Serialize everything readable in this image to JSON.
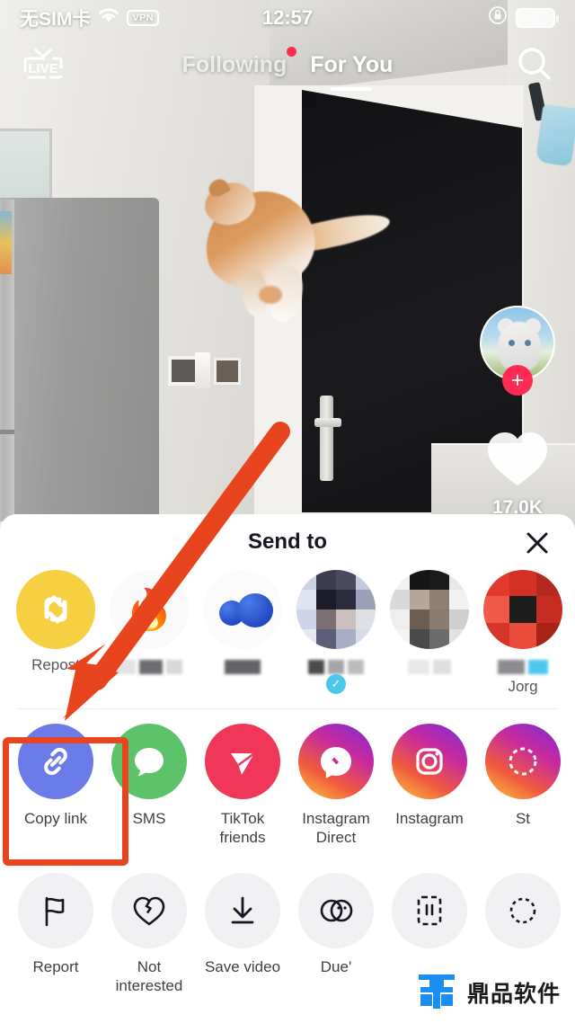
{
  "statusbar": {
    "carrier": "无SIM卡",
    "wifi_icon": "wifi-icon",
    "vpn_label": "VPN",
    "time": "12:57",
    "rotation_lock_icon": "rotation-lock-icon",
    "battery_icon": "battery-icon"
  },
  "topnav": {
    "live_label": "LIVE",
    "tabs": [
      {
        "label": "Following",
        "active": false,
        "has_dot": true
      },
      {
        "label": "For You",
        "active": true,
        "has_dot": false
      }
    ],
    "search_icon": "search-icon"
  },
  "video": {
    "author_avatar_icon": "author-avatar",
    "follow_button_label": "+",
    "like_icon": "heart-icon",
    "like_count": "17.0K"
  },
  "share_sheet": {
    "title": "Send to",
    "close_icon": "close-icon",
    "contacts": [
      {
        "label": "Repost",
        "icon": "repost-icon",
        "name_blurred": false,
        "verified": false
      },
      {
        "label": "",
        "icon": "fire-emoji-avatar",
        "name_blurred": true,
        "verified": false
      },
      {
        "label": "",
        "icon": "blue-faces-avatar",
        "name_blurred": true,
        "verified": false
      },
      {
        "label": "",
        "icon": "pixelated-avatar-1",
        "name_blurred": true,
        "verified": true
      },
      {
        "label": "",
        "icon": "pixelated-avatar-2",
        "name_blurred": true,
        "verified": false
      },
      {
        "label": "Jorg",
        "icon": "pixelated-avatar-3",
        "name_blurred": false,
        "verified": false
      }
    ],
    "apps": [
      {
        "label": "Copy link",
        "icon": "link-icon",
        "highlighted": true
      },
      {
        "label": "SMS",
        "icon": "sms-icon",
        "highlighted": false
      },
      {
        "label": "TikTok friends",
        "icon": "tiktok-friends-icon",
        "highlighted": false
      },
      {
        "label": "Instagram Direct",
        "icon": "instagram-direct-icon",
        "highlighted": false
      },
      {
        "label": "Instagram",
        "icon": "instagram-icon",
        "highlighted": false
      },
      {
        "label": "St",
        "icon": "instagram-stories-icon",
        "highlighted": false
      }
    ],
    "actions": [
      {
        "label": "Report",
        "icon": "flag-icon"
      },
      {
        "label": "Not interested",
        "icon": "broken-heart-icon"
      },
      {
        "label": "Save video",
        "icon": "download-icon"
      },
      {
        "label": "Due'",
        "icon": "duet-icon"
      },
      {
        "label": "",
        "icon": "green-screen-icon"
      },
      {
        "label": "",
        "icon": "stitch-icon"
      }
    ]
  },
  "annotation": {
    "highlight_color": "#e8441e",
    "arrow_color": "#e8441e",
    "target": "Copy link"
  },
  "watermark": {
    "text": "鼎品软件",
    "logo_icon": "dingpin-logo-icon",
    "color": "#1b8ef2"
  }
}
